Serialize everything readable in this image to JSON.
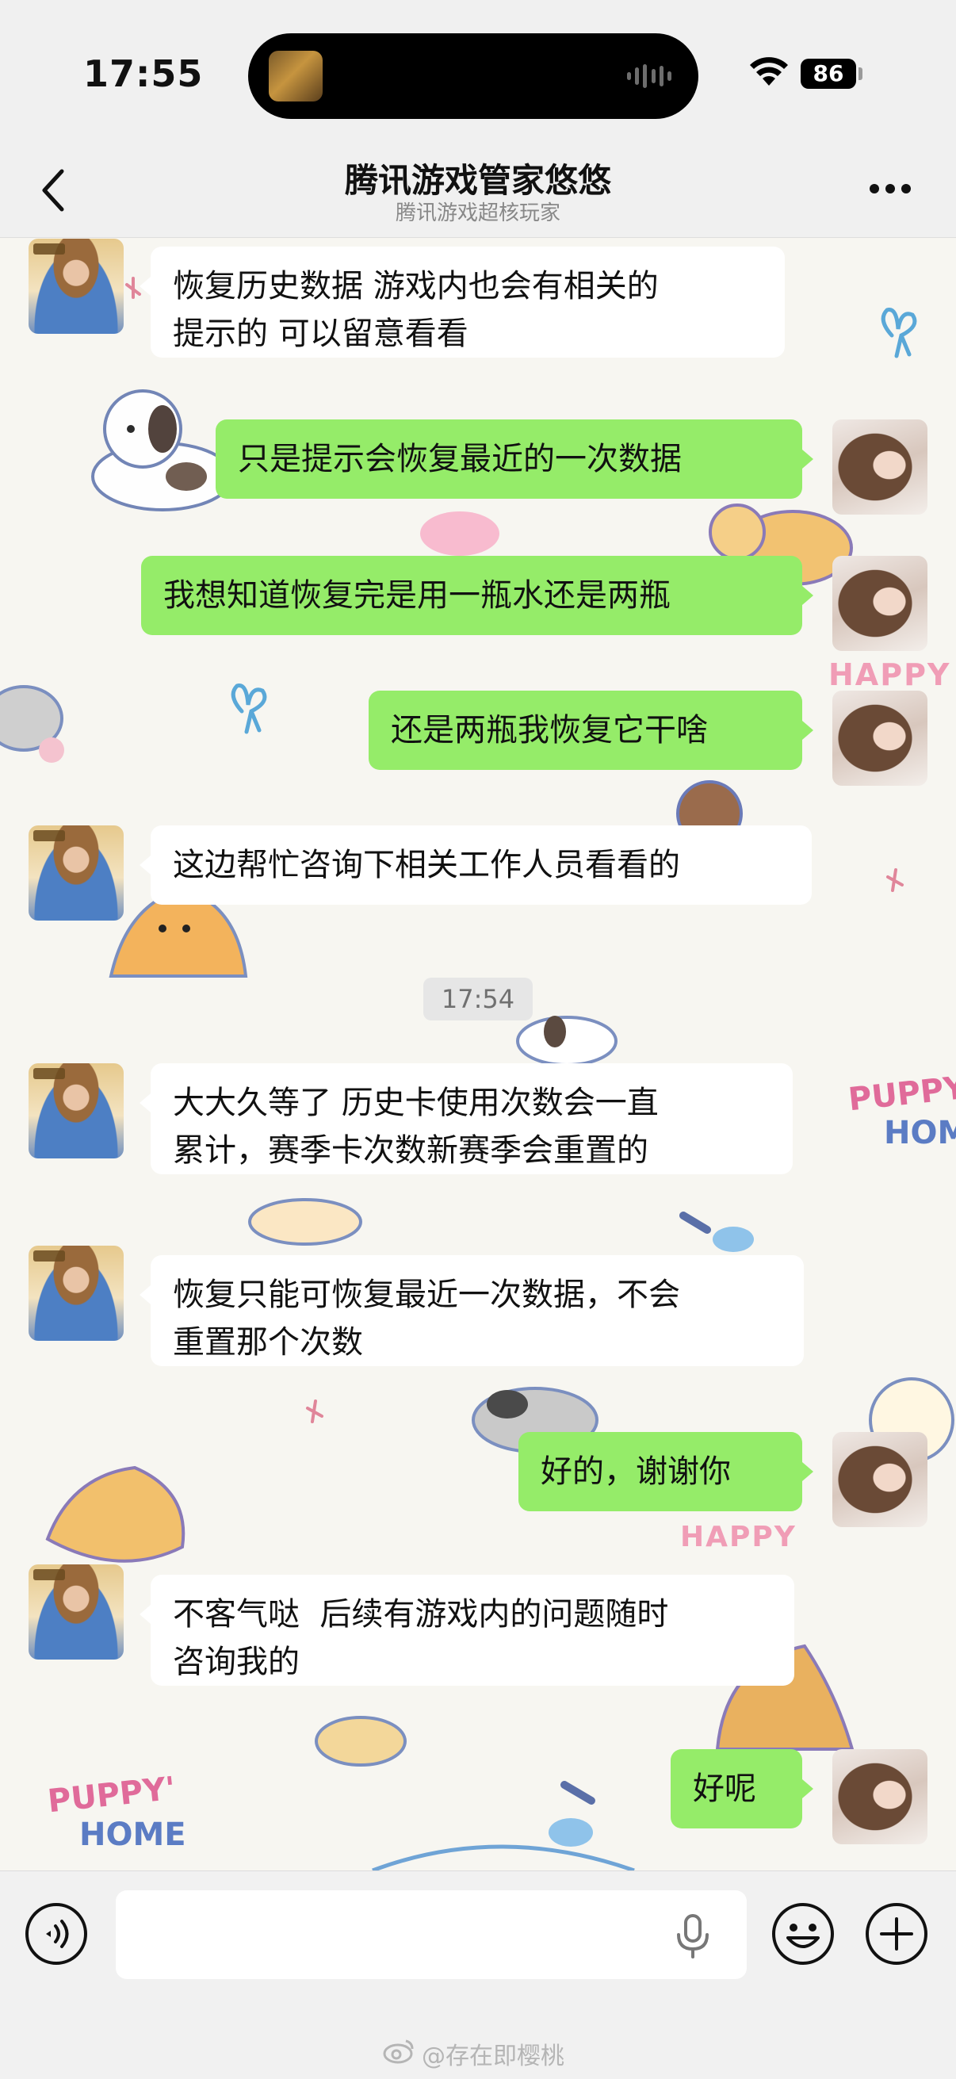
{
  "status_bar": {
    "time": "17:55",
    "battery": "86",
    "icons": [
      "wifi-icon",
      "audio-wave-icon"
    ]
  },
  "nav": {
    "title": "腾讯游戏管家悠悠",
    "subtitle": "腾讯游戏超核玩家",
    "icons": [
      "chevron-left-icon",
      "more-icon"
    ]
  },
  "messages": [
    {
      "side": "left",
      "text": "恢复历史数据 游戏内也会有相关的\n提示的 可以留意看看"
    },
    {
      "side": "right",
      "text": "只是提示会恢复最近的一次数据"
    },
    {
      "side": "right",
      "text": "我想知道恢复完是用一瓶水还是两瓶"
    },
    {
      "side": "right",
      "text": "还是两瓶我恢复它干啥"
    },
    {
      "side": "left",
      "text": "这边帮忙咨询下相关工作人员看看的"
    },
    {
      "side": "left",
      "text": "大大久等了 历史卡使用次数会一直\n累计，赛季卡次数新赛季会重置的"
    },
    {
      "side": "left",
      "text": "恢复只能可恢复最近一次数据，不会\n重置那个次数"
    },
    {
      "side": "right",
      "text": "好的，谢谢你"
    },
    {
      "side": "left",
      "text": "不客气哒  后续有游戏内的问题随时\n咨询我的"
    },
    {
      "side": "right",
      "text": "好呢"
    }
  ],
  "timestamp": "17:54",
  "wallpaper_text": [
    "HAPPY",
    "HAPPY",
    "PUPPY'",
    "HOME",
    "PUPPY'",
    "HOME"
  ],
  "input": {
    "value": "",
    "icons": [
      "voice-icon",
      "mic-icon",
      "emoji-icon",
      "plus-icon"
    ]
  },
  "watermark": "@存在即樱桃",
  "colors": {
    "user_bubble": "#95ec69",
    "agent_bubble": "#ffffff",
    "bar_background": "#f0f0f0",
    "timestamp_text": "#707070"
  }
}
